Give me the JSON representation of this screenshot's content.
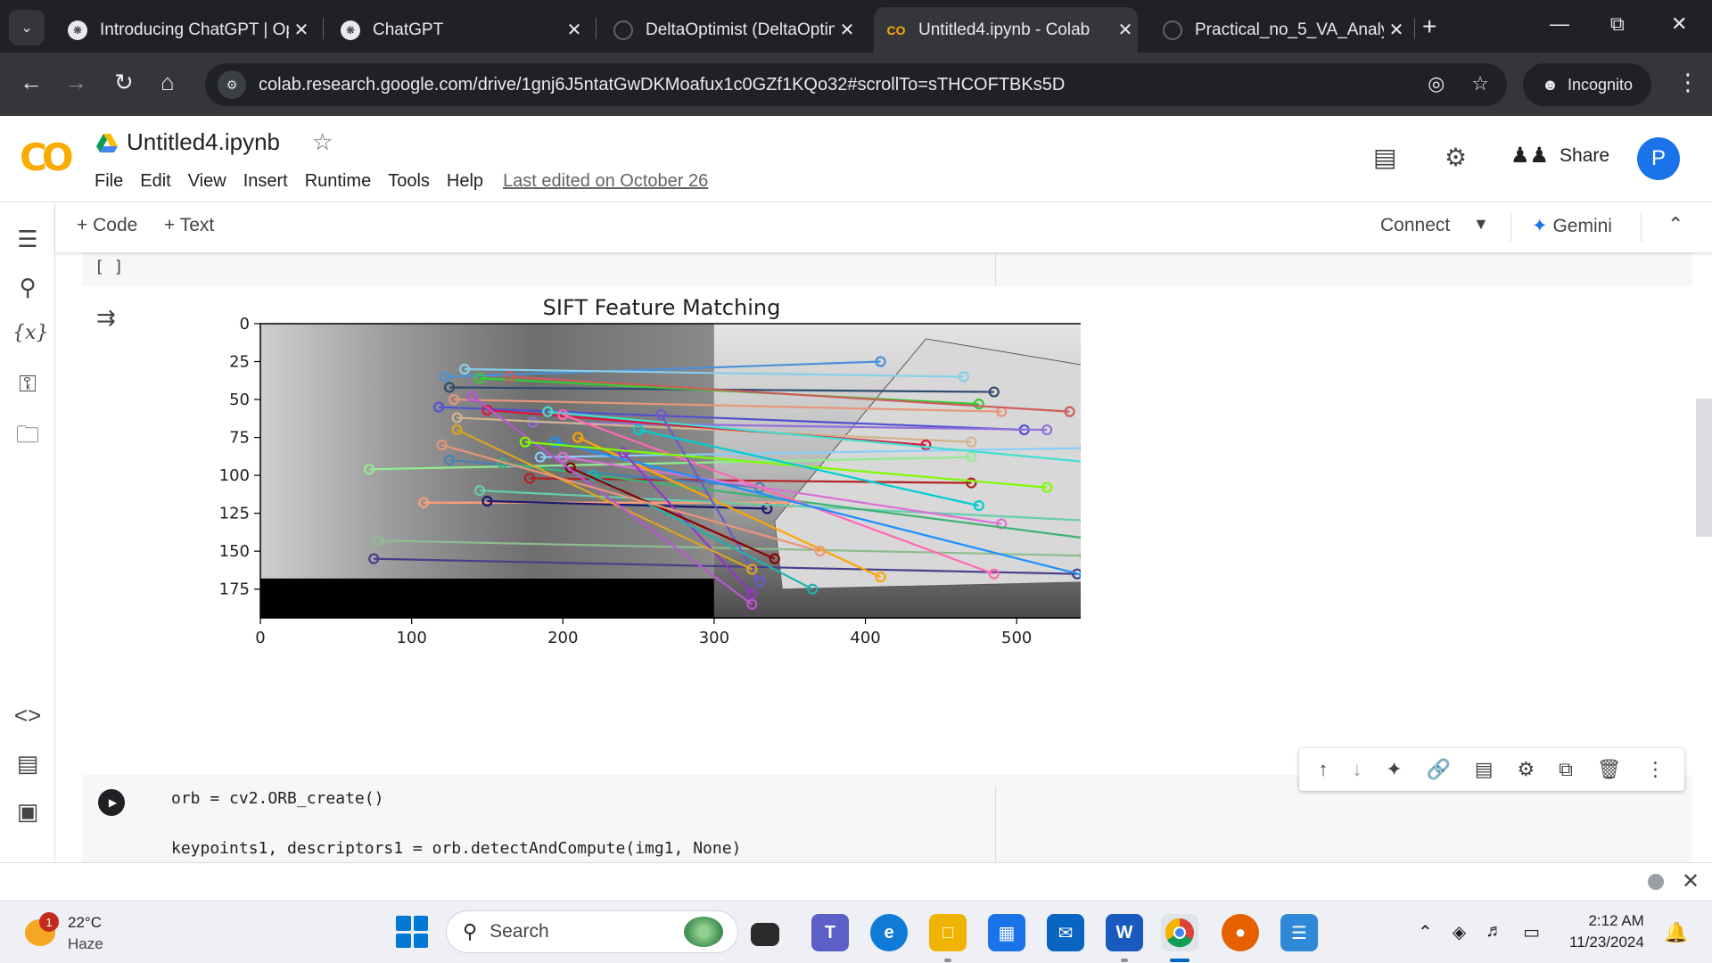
{
  "browser": {
    "tabs": [
      {
        "title": "Introducing ChatGPT | OpenAI",
        "active": false
      },
      {
        "title": "ChatGPT",
        "active": false
      },
      {
        "title": "DeltaOptimist (DeltaOptimist)",
        "active": false
      },
      {
        "title": "Untitled4.ipynb - Colab",
        "active": true
      },
      {
        "title": "Practical_no_5_VA_Analytics",
        "active": false
      }
    ],
    "url": "colab.research.google.com/drive/1gnj6J5ntatGwDKMoafux1c0GZf1KQo32#scrollTo=sTHCOFTBKs5D",
    "incognito_label": "Incognito"
  },
  "colab": {
    "logo": "CO",
    "notebook_title": "Untitled4.ipynb",
    "menu": [
      "File",
      "Edit",
      "View",
      "Insert",
      "Runtime",
      "Tools",
      "Help"
    ],
    "last_edited": "Last edited on October 26",
    "share_label": "Share",
    "avatar_letter": "P",
    "toolbar": {
      "add_code": "+ Code",
      "add_text": "+ Text",
      "connect": "Connect",
      "gemini": "Gemini"
    }
  },
  "cells": {
    "prev_exec": "[ ]",
    "code_lines": [
      "orb = cv2.ORB_create()",
      "keypoints1, descriptors1 = orb.detectAndCompute(img1, None)"
    ]
  },
  "chart_data": {
    "type": "image",
    "title": "SIFT Feature Matching",
    "xlabel": "",
    "ylabel": "",
    "xlim": [
      0,
      560
    ],
    "ylim": [
      194,
      0
    ],
    "xticks": [
      0,
      100,
      200,
      300,
      400,
      500
    ],
    "yticks": [
      0,
      25,
      50,
      75,
      100,
      125,
      150,
      175
    ],
    "left_image_width": 300,
    "left_image_height": 168,
    "matches": [
      {
        "x1": 122,
        "y1": 35,
        "x2": 410,
        "y2": 25,
        "color": "#4a90d9"
      },
      {
        "x1": 135,
        "y1": 30,
        "x2": 465,
        "y2": 35,
        "color": "#87ceeb"
      },
      {
        "x1": 125,
        "y1": 42,
        "x2": 485,
        "y2": 45,
        "color": "#2e4a6e"
      },
      {
        "x1": 145,
        "y1": 36,
        "x2": 475,
        "y2": 53,
        "color": "#32cd32"
      },
      {
        "x1": 128,
        "y1": 50,
        "x2": 490,
        "y2": 58,
        "color": "#e9967a"
      },
      {
        "x1": 165,
        "y1": 35,
        "x2": 535,
        "y2": 58,
        "color": "#cd5c5c"
      },
      {
        "x1": 118,
        "y1": 55,
        "x2": 505,
        "y2": 70,
        "color": "#5050d0"
      },
      {
        "x1": 180,
        "y1": 65,
        "x2": 520,
        "y2": 70,
        "color": "#9370db"
      },
      {
        "x1": 130,
        "y1": 62,
        "x2": 470,
        "y2": 78,
        "color": "#d2b48c"
      },
      {
        "x1": 150,
        "y1": 57,
        "x2": 440,
        "y2": 80,
        "color": "#dc143c"
      },
      {
        "x1": 185,
        "y1": 88,
        "x2": 545,
        "y2": 82,
        "color": "#87cefa"
      },
      {
        "x1": 72,
        "y1": 96,
        "x2": 470,
        "y2": 88,
        "color": "#90ee90"
      },
      {
        "x1": 190,
        "y1": 58,
        "x2": 555,
        "y2": 92,
        "color": "#40e0d0"
      },
      {
        "x1": 178,
        "y1": 102,
        "x2": 470,
        "y2": 105,
        "color": "#b22222"
      },
      {
        "x1": 125,
        "y1": 90,
        "x2": 330,
        "y2": 108,
        "color": "#4682b4"
      },
      {
        "x1": 108,
        "y1": 118,
        "x2": 350,
        "y2": 118,
        "color": "#ffa07a"
      },
      {
        "x1": 150,
        "y1": 117,
        "x2": 335,
        "y2": 122,
        "color": "#191970"
      },
      {
        "x1": 145,
        "y1": 110,
        "x2": 550,
        "y2": 130,
        "color": "#66cdaa"
      },
      {
        "x1": 200,
        "y1": 88,
        "x2": 490,
        "y2": 132,
        "color": "#da70d6"
      },
      {
        "x1": 160,
        "y1": 92,
        "x2": 550,
        "y2": 142,
        "color": "#3cb371"
      },
      {
        "x1": 78,
        "y1": 143,
        "x2": 545,
        "y2": 153,
        "color": "#8fbc8f"
      },
      {
        "x1": 75,
        "y1": 155,
        "x2": 540,
        "y2": 165,
        "color": "#483d8b"
      },
      {
        "x1": 200,
        "y1": 60,
        "x2": 485,
        "y2": 165,
        "color": "#ff69b4"
      },
      {
        "x1": 210,
        "y1": 75,
        "x2": 410,
        "y2": 167,
        "color": "#ffa500"
      },
      {
        "x1": 195,
        "y1": 78,
        "x2": 545,
        "y2": 166,
        "color": "#1e90ff"
      },
      {
        "x1": 265,
        "y1": 60,
        "x2": 330,
        "y2": 170,
        "color": "#6a5acd"
      },
      {
        "x1": 240,
        "y1": 85,
        "x2": 325,
        "y2": 178,
        "color": "#9932cc"
      },
      {
        "x1": 220,
        "y1": 100,
        "x2": 365,
        "y2": 175,
        "color": "#20b2aa"
      },
      {
        "x1": 130,
        "y1": 70,
        "x2": 325,
        "y2": 162,
        "color": "#daa520"
      },
      {
        "x1": 205,
        "y1": 95,
        "x2": 340,
        "y2": 155,
        "color": "#8b0000"
      },
      {
        "x1": 140,
        "y1": 48,
        "x2": 325,
        "y2": 185,
        "color": "#ba55d3"
      },
      {
        "x1": 120,
        "y1": 80,
        "x2": 370,
        "y2": 150,
        "color": "#e9967a"
      },
      {
        "x1": 175,
        "y1": 78,
        "x2": 520,
        "y2": 108,
        "color": "#7cfc00"
      },
      {
        "x1": 250,
        "y1": 70,
        "x2": 475,
        "y2": 120,
        "color": "#00ced1"
      }
    ]
  }
}
